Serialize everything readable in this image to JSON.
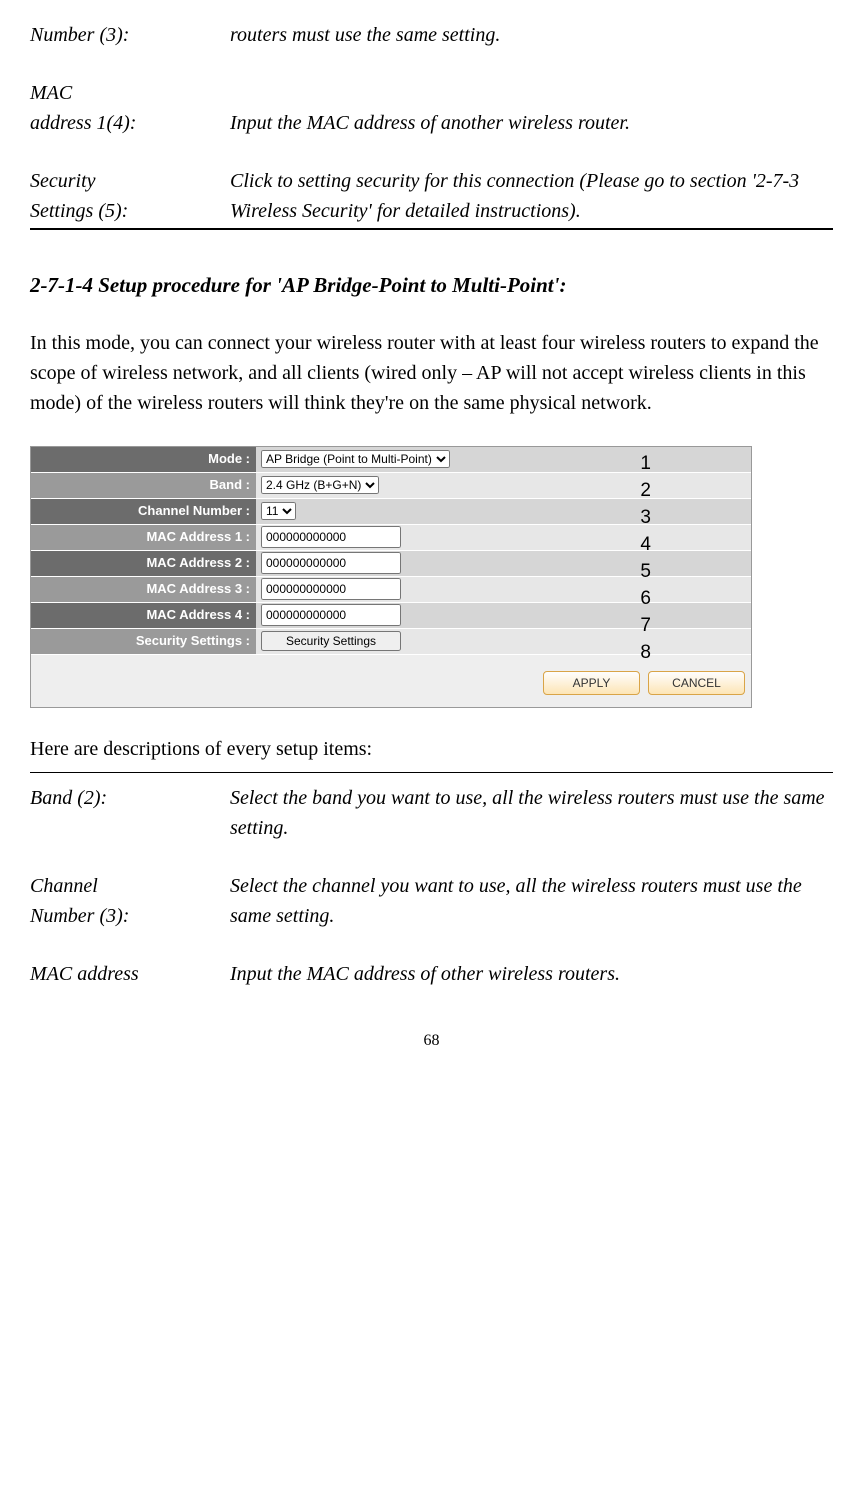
{
  "defs_top": [
    {
      "label": "Number (3):",
      "desc": "routers must use the same setting."
    },
    {
      "label": "MAC address 1(4):",
      "desc": "Input the MAC address of another wireless router."
    },
    {
      "label": "Security Settings (5):",
      "desc": "Click to setting security for this connection (Please go to section '2-7-3 Wireless Security' for detailed instructions)."
    }
  ],
  "section_heading": "2-7-1-4 Setup procedure for 'AP Bridge-Point to Multi-Point':",
  "body_p": "In this mode, you can connect your wireless router with at least four wireless routers to expand the scope of wireless network, and all clients (wired only – AP will not accept wireless clients in this mode) of the wireless routers will think they're on the same physical network.",
  "router_ui": {
    "rows": {
      "mode": {
        "label": "Mode :",
        "value": "AP Bridge (Point to Multi-Point)",
        "callout": "1"
      },
      "band": {
        "label": "Band :",
        "value": "2.4 GHz (B+G+N)",
        "callout": "2"
      },
      "channel": {
        "label": "Channel Number :",
        "value": "11",
        "callout": "3"
      },
      "mac1": {
        "label": "MAC Address 1 :",
        "value": "000000000000",
        "callout": "4"
      },
      "mac2": {
        "label": "MAC Address 2 :",
        "value": "000000000000",
        "callout": "5"
      },
      "mac3": {
        "label": "MAC Address 3 :",
        "value": "000000000000",
        "callout": "6"
      },
      "mac4": {
        "label": "MAC Address 4 :",
        "value": "000000000000",
        "callout": "7"
      },
      "security": {
        "label": "Security Settings :",
        "btn": "Security Settings",
        "callout": "8"
      }
    },
    "apply": "APPLY",
    "cancel": "CANCEL"
  },
  "below_text": "Here are descriptions of every setup items:",
  "defs_bottom": [
    {
      "label": "Band (2):",
      "desc": "Select the band you want to use, all the wireless routers must use the same setting."
    },
    {
      "label": "Channel Number (3):",
      "desc": "Select the channel you want to use, all the wireless routers must use the same setting."
    },
    {
      "label": "MAC address",
      "desc": "Input the MAC address of other wireless routers."
    }
  ],
  "page_num": "68"
}
